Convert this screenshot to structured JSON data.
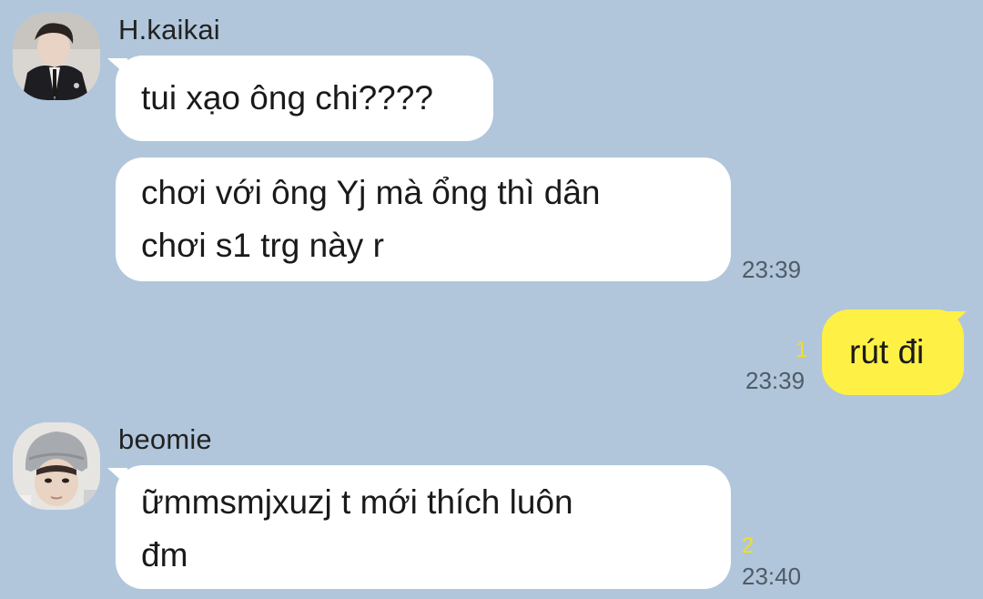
{
  "colors": {
    "background": "#b1c6db",
    "incoming_bubble": "#ffffff",
    "outgoing_bubble": "#fff046",
    "unread_count": "#f2df1d",
    "timestamp": "#4f5b66"
  },
  "messages": [
    {
      "sender": "H.kaikai",
      "avatar": "avatar-photo",
      "bubbles": [
        {
          "text": "tui xạo ông chi????"
        },
        {
          "line1": "chơi với ông Yj mà ổng thì dân",
          "line2": "chơi s1 trg này r"
        }
      ],
      "time": "23:39"
    },
    {
      "sender": "me",
      "text": "rút đi",
      "unread": "1",
      "time": "23:39"
    },
    {
      "sender": "beomie",
      "avatar": "avatar-photo",
      "line1": "ữmmsmjxuzj t mới thích luôn",
      "line2": "đm",
      "unread": "2",
      "time": "23:40"
    }
  ]
}
